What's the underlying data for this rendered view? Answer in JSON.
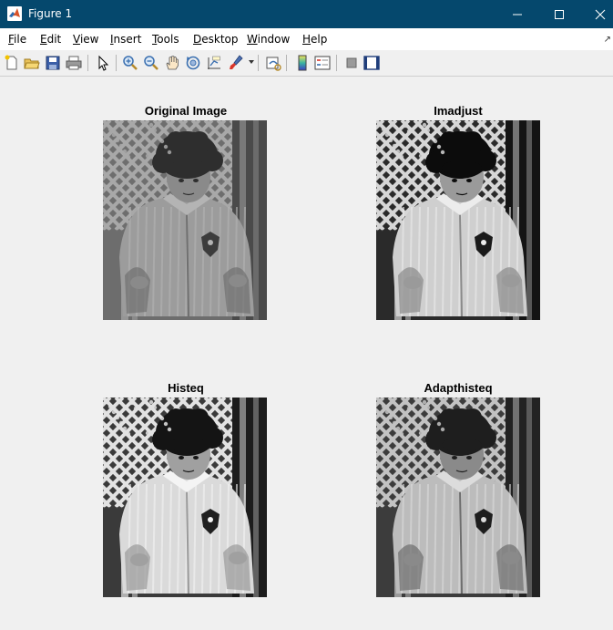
{
  "window": {
    "title": "Figure 1"
  },
  "menu": {
    "items": [
      {
        "label": "File",
        "accel": "F",
        "rest": "ile"
      },
      {
        "label": "Edit",
        "accel": "E",
        "rest": "dit"
      },
      {
        "label": "View",
        "accel": "V",
        "rest": "iew"
      },
      {
        "label": "Insert",
        "accel": "I",
        "rest": "nsert"
      },
      {
        "label": "Tools",
        "accel": "T",
        "rest": "ools"
      },
      {
        "label": "Desktop",
        "accel": "D",
        "rest": "esktop"
      },
      {
        "label": "Window",
        "accel": "W",
        "rest": "indow"
      },
      {
        "label": "Help",
        "accel": "H",
        "rest": "elp"
      }
    ]
  },
  "toolbar": {
    "icons": [
      "new-figure-icon",
      "open-file-icon",
      "save-icon",
      "print-icon",
      "edit-plot-arrow-icon",
      "zoom-in-icon",
      "zoom-out-icon",
      "pan-hand-icon",
      "rotate-3d-icon",
      "data-cursor-icon",
      "brush-icon",
      "link-plot-icon",
      "insert-colorbar-icon",
      "insert-legend-icon",
      "hide-plot-tools-icon",
      "show-plot-tools-icon"
    ]
  },
  "axes": [
    {
      "title": "Original Image",
      "variant": "original"
    },
    {
      "title": "Imadjust",
      "variant": "imadjust"
    },
    {
      "title": "Histeq",
      "variant": "histeq"
    },
    {
      "title": "Adapthisteq",
      "variant": "adapthisteq"
    }
  ],
  "colors": {
    "titlebar": "#05486d",
    "background": "#f0f0f0",
    "menubar": "#ffffff"
  }
}
